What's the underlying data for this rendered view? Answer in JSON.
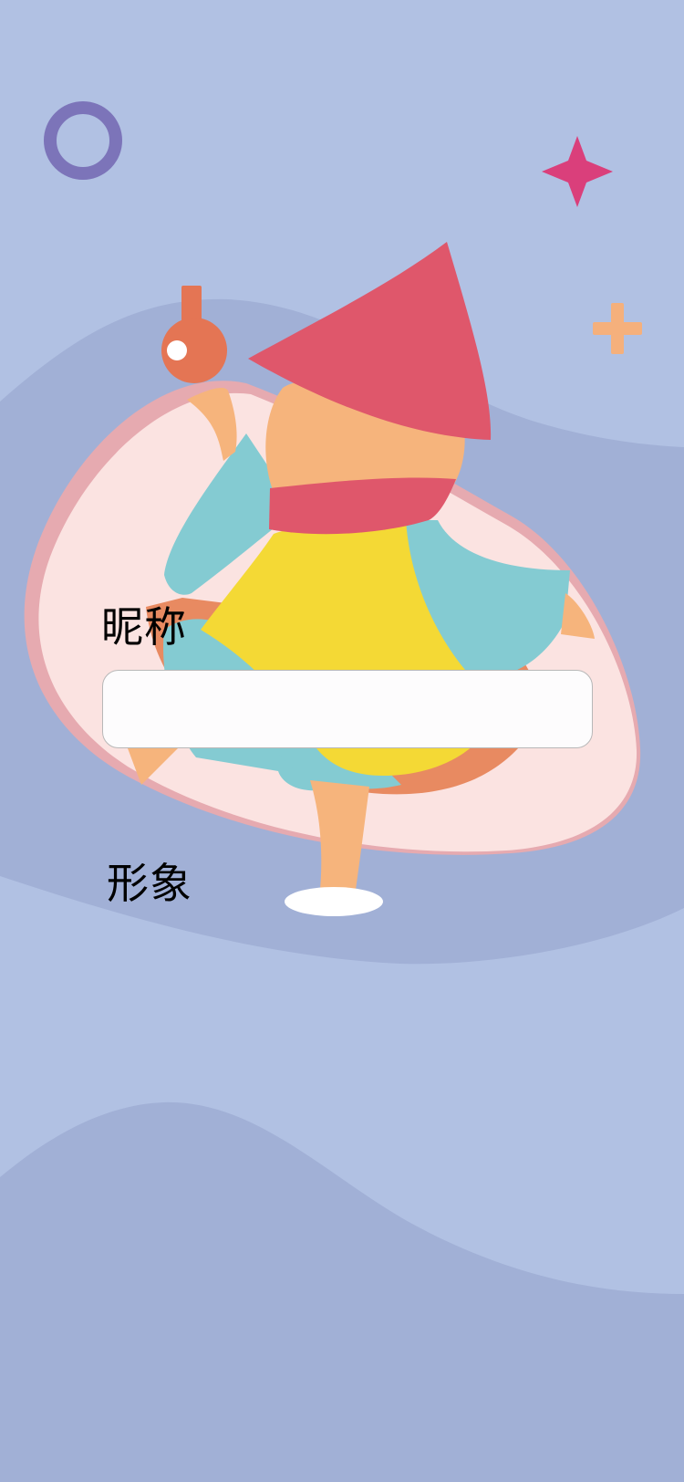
{
  "form": {
    "nickname": {
      "label": "昵称",
      "value": "",
      "placeholder": ""
    },
    "avatar": {
      "label": "形象"
    }
  },
  "colors": {
    "background": "#b1c1e3",
    "wave": "#a1b0d6",
    "ring": "#7c74b9",
    "star": "#da3f7b",
    "plus": "#f5b07c",
    "hat": "#df576b",
    "scarf": "#df576b",
    "coat": "#84cbd2",
    "shirt": "#f4d935",
    "skin": "#f6b47c",
    "headphone": "#e47554",
    "blob": "#fbe3e1",
    "blob_edge": "#e6aab0"
  }
}
